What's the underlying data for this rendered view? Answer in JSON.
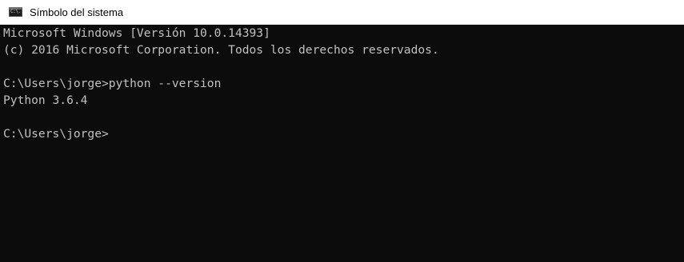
{
  "window": {
    "title": "Símbolo del sistema",
    "icon": "cmd-icon",
    "icon_glyph": "C:\\."
  },
  "console": {
    "text_color": "#c0c0c0",
    "background_color": "#0c0c0c",
    "lines": [
      "Microsoft Windows [Versión 10.0.14393]",
      "(c) 2016 Microsoft Corporation. Todos los derechos reservados.",
      "",
      "C:\\Users\\jorge>python --version",
      "Python 3.6.4",
      "",
      "C:\\Users\\jorge>"
    ]
  }
}
